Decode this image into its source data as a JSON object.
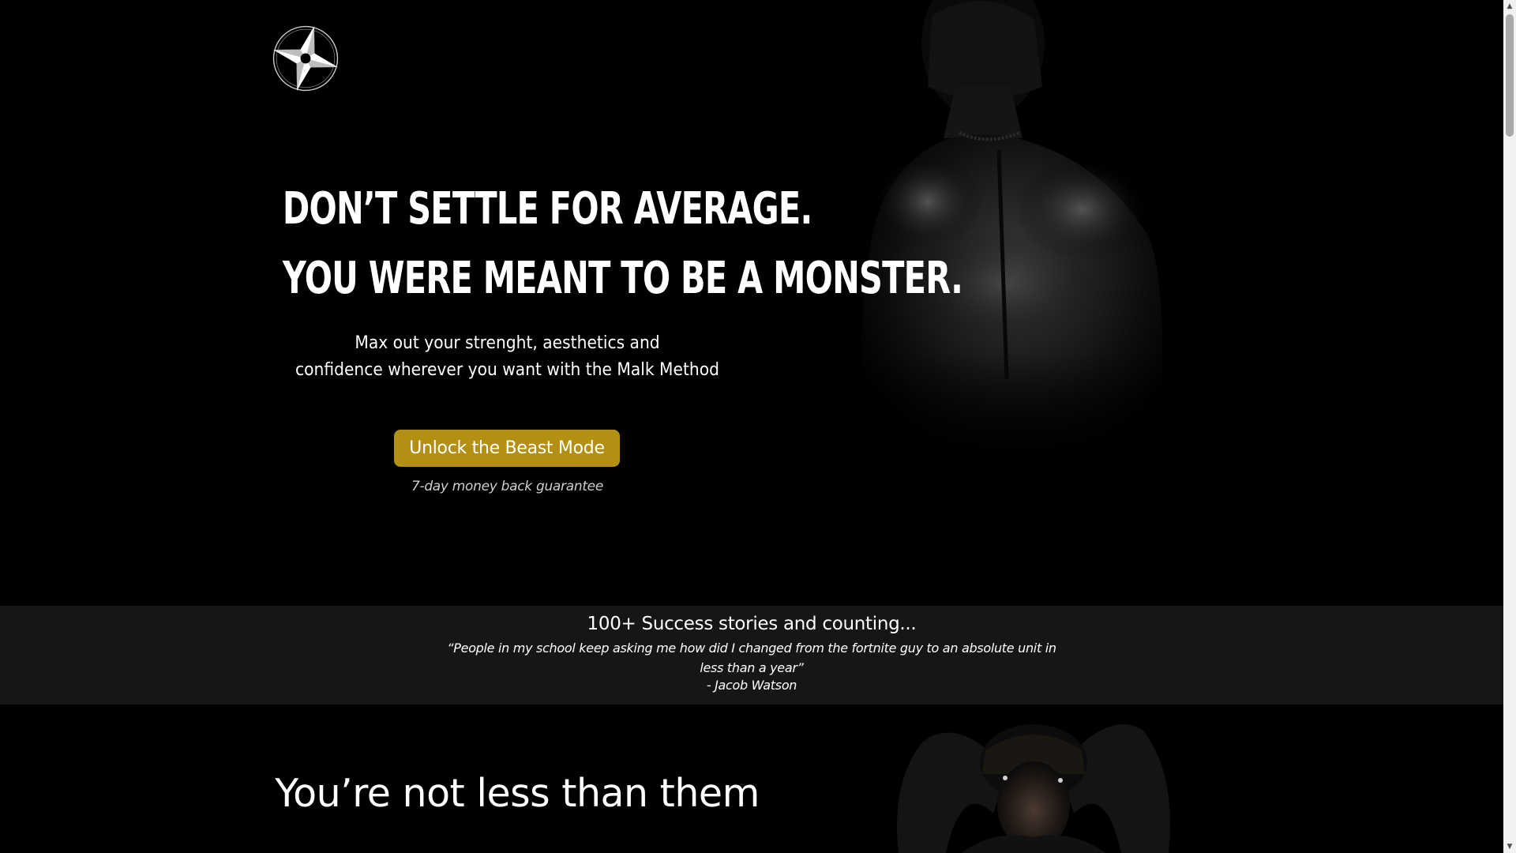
{
  "hero": {
    "headline_line1": "Don’t settle for average.",
    "headline_line2": "You were meant to be a monster.",
    "subtext_line1": "Max out your strenght, aesthetics and",
    "subtext_line2": "confidence wherever you want with the Malk Method",
    "cta_label": "Unlock the Beast Mode",
    "guarantee": "7-day money back guarantee"
  },
  "logo": {
    "icon": "shuriken-icon"
  },
  "testimonials": {
    "title": "100+ Success stories and counting...",
    "quote": "“People in my school keep asking me how did I changed from the fortnite guy to an absolute unit in less than a year”",
    "author": "- Jacob Watson"
  },
  "section2": {
    "heading": "You’re not less than them"
  },
  "colors": {
    "background": "#000000",
    "accent": "#b39012",
    "band": "#161616",
    "text": "#ffffff"
  }
}
